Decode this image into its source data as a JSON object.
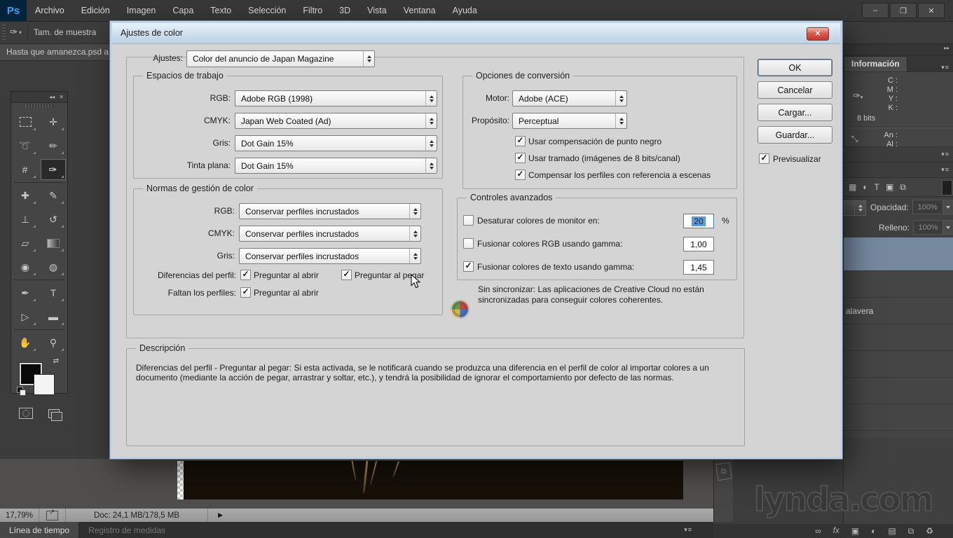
{
  "colors": {
    "accent_blue": "#33a3ef",
    "dialog_titlebar": "#cfdfee",
    "text_selection": "#5f9bd3",
    "layer_selected": "#75889e",
    "dialog_bg": "#d4d4d4",
    "panel_bg": "#454545"
  },
  "menubar": {
    "logo": "Ps",
    "items": [
      "Archivo",
      "Edición",
      "Imagen",
      "Capa",
      "Texto",
      "Selección",
      "Filtro",
      "3D",
      "Vista",
      "Ventana",
      "Ayuda"
    ],
    "window_controls": [
      {
        "name": "minimize-button",
        "glyph": "–"
      },
      {
        "name": "restore-button",
        "glyph": "❐"
      },
      {
        "name": "close-button",
        "glyph": "✕"
      }
    ]
  },
  "options_bar": {
    "tool_sample_label": "Tam. de muestra"
  },
  "document_tab": {
    "title": "Hasta que amanezca.psd a"
  },
  "toolbox": {
    "collapse_icon": "◂◂",
    "close_icon": "✕",
    "tools": [
      {
        "name": "rectangular-marquee-tool",
        "style": "marquee"
      },
      {
        "name": "move-tool",
        "glyph": "✛"
      },
      {
        "name": "lasso-tool",
        "glyph": "➰"
      },
      {
        "name": "quick-selection-tool",
        "glyph": "✏"
      },
      {
        "name": "crop-tool",
        "glyph": "#"
      },
      {
        "name": "eyedropper-tool",
        "glyph": "✑",
        "selected": true
      },
      {
        "name": "healing-brush-tool",
        "glyph": "✚"
      },
      {
        "name": "brush-tool",
        "glyph": "✎"
      },
      {
        "name": "clone-stamp-tool",
        "glyph": "⊥"
      },
      {
        "name": "history-brush-tool",
        "glyph": "↺"
      },
      {
        "name": "eraser-tool",
        "glyph": "▱"
      },
      {
        "name": "gradient-tool",
        "style": "gradient"
      },
      {
        "name": "blur-tool",
        "glyph": "◉"
      },
      {
        "name": "dodge-tool",
        "glyph": "◍"
      },
      {
        "name": "pen-tool",
        "glyph": "✒"
      },
      {
        "name": "type-tool",
        "glyph": "T"
      },
      {
        "name": "path-selection-tool",
        "glyph": "▷"
      },
      {
        "name": "shape-tool",
        "glyph": "▬"
      },
      {
        "name": "hand-tool",
        "glyph": "✋"
      },
      {
        "name": "zoom-tool",
        "glyph": "⚲"
      }
    ],
    "dividers_after_row": [
      3,
      7,
      9
    ]
  },
  "dialog": {
    "title": "Ajustes de color",
    "settings": {
      "label": "Ajustes:",
      "value": "Color del anuncio de Japan Magazine"
    },
    "workspaces": {
      "title": "Espacios de trabajo",
      "rows": [
        {
          "label": "RGB:",
          "value": "Adobe RGB (1998)"
        },
        {
          "label": "CMYK:",
          "value": "Japan Web Coated (Ad)"
        },
        {
          "label": "Gris:",
          "value": "Dot Gain 15%"
        },
        {
          "label": "Tinta plana:",
          "value": "Dot Gain 15%"
        }
      ]
    },
    "policies": {
      "title": "Normas de gestión de color",
      "rows": [
        {
          "label": "RGB:",
          "value": "Conservar perfiles incrustados"
        },
        {
          "label": "CMYK:",
          "value": "Conservar perfiles incrustados"
        },
        {
          "label": "Gris:",
          "value": "Conservar perfiles incrustados"
        }
      ],
      "profile_mismatches": {
        "label": "Diferencias del perfil:",
        "options": [
          {
            "label": "Preguntar al abrir",
            "checked": true
          },
          {
            "label": "Preguntar al pegar",
            "checked": true
          }
        ]
      },
      "missing_profiles": {
        "label": "Faltan los perfiles:",
        "options": [
          {
            "label": "Preguntar al abrir",
            "checked": true
          }
        ]
      }
    },
    "conversion": {
      "title": "Opciones de conversión",
      "engine": {
        "label": "Motor:",
        "value": "Adobe (ACE)"
      },
      "intent": {
        "label": "Propósito:",
        "value": "Perceptual"
      },
      "checkboxes": [
        {
          "label": "Usar compensación de punto negro",
          "checked": true
        },
        {
          "label": "Usar tramado (imágenes de 8 bits/canal)",
          "checked": true
        },
        {
          "label": "Compensar los perfiles con referencia a escenas",
          "checked": true
        }
      ]
    },
    "advanced": {
      "title": "Controles avanzados",
      "rows": [
        {
          "label": "Desaturar colores de monitor en:",
          "checked": false,
          "value": "20",
          "suffix": "%",
          "text_selected": true
        },
        {
          "label": "Fusionar colores RGB usando gamma:",
          "checked": false,
          "value": "1,00",
          "suffix": "",
          "text_selected": false
        },
        {
          "label": "Fusionar colores de texto usando gamma:",
          "checked": true,
          "value": "1,45",
          "suffix": "",
          "text_selected": false
        }
      ]
    },
    "sync_notice": {
      "line1": "Sin sincronizar: Las aplicaciones de Creative Cloud no están",
      "line2": "sincronizadas para conseguir colores coherentes."
    },
    "description": {
      "title": "Descripción",
      "text": "Diferencias del perfil - Preguntar al pegar: Si esta activada, se le notificará cuando se produzca una diferencia en el perfil de color al importar colores a un documento (mediante la acción de pegar, arrastrar y soltar, etc.), y tendrá la posibilidad de ignorar el comportamiento por defecto de las normas."
    },
    "buttons": {
      "ok": "OK",
      "cancel": "Cancelar",
      "load": "Cargar...",
      "save": "Guardar...",
      "preview": {
        "label": "Previsualizar",
        "checked": true
      }
    }
  },
  "panels": {
    "collapse_icon": "▸▸",
    "info": {
      "tab": "Información",
      "cmyk": [
        "C :",
        "M :",
        "Y :",
        "K :"
      ],
      "bits": "8 bits",
      "dims": [
        "An :",
        "Al :"
      ]
    },
    "layers": {
      "filter_icons": [
        {
          "name": "filter-pixel-layers-icon",
          "glyph": "▦"
        },
        {
          "name": "filter-adjustment-layers-icon",
          "glyph": "◐"
        },
        {
          "name": "filter-type-layers-icon",
          "glyph": "T"
        },
        {
          "name": "filter-shape-layers-icon",
          "glyph": "▣"
        },
        {
          "name": "filter-smart-objects-icon",
          "glyph": "⧉"
        }
      ],
      "opacity": {
        "label": "Opacidad:",
        "value": "100%"
      },
      "fill": {
        "label": "Relleno:",
        "value": "100%"
      },
      "rows": [
        {
          "label": "",
          "selected": true
        },
        {
          "label": "",
          "selected": false
        },
        {
          "label": "alavera",
          "selected": false
        },
        {
          "label": "",
          "selected": false
        },
        {
          "label": "",
          "selected": false
        },
        {
          "label": "",
          "selected": false
        },
        {
          "label": "",
          "selected": false
        },
        {
          "label": "",
          "selected": false
        },
        {
          "label": "",
          "selected": false
        }
      ],
      "footer_icons": [
        {
          "name": "link-layers-icon",
          "glyph": "∞"
        },
        {
          "name": "layer-effects-icon",
          "glyph": "fx"
        },
        {
          "name": "layer-mask-icon",
          "glyph": "▣"
        },
        {
          "name": "adjustment-layer-icon",
          "glyph": "◐"
        },
        {
          "name": "layer-group-icon",
          "glyph": "▤"
        },
        {
          "name": "new-layer-icon",
          "glyph": "⧉"
        },
        {
          "name": "delete-layer-icon",
          "glyph": "♻"
        }
      ]
    }
  },
  "status_bar": {
    "zoom": "17,79%",
    "doc": "Doc: 24,1 MB/178,5 MB"
  },
  "bottom_tabs": {
    "tabs": [
      {
        "label": "Línea de tiempo",
        "active": true
      },
      {
        "label": "Registro de medidas",
        "active": false
      }
    ]
  },
  "watermark": "lynda.com"
}
